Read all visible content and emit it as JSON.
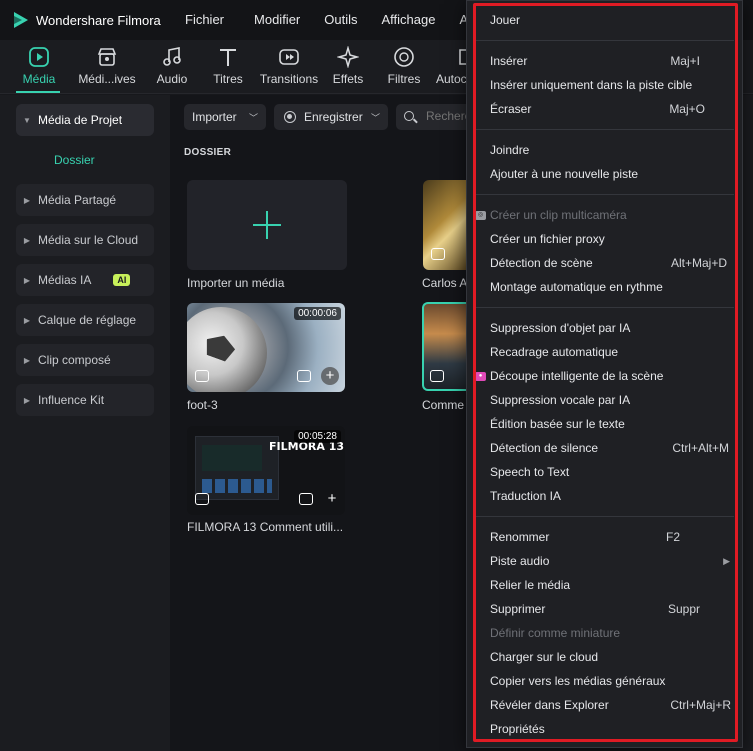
{
  "app": {
    "title": "Wondershare Filmora",
    "menus": [
      "Fichier",
      "Modifier",
      "Outils",
      "Affichage",
      "Aide"
    ]
  },
  "toolbar": {
    "tabs": [
      {
        "label": "Média",
        "icon": "media-icon",
        "active": true
      },
      {
        "label": "Médi...ives",
        "icon": "store-icon",
        "active": false
      },
      {
        "label": "Audio",
        "icon": "music-note-icon",
        "active": false
      },
      {
        "label": "Titres",
        "icon": "text-t-icon",
        "active": false
      },
      {
        "label": "Transitions",
        "icon": "transition-icon",
        "active": false
      },
      {
        "label": "Effets",
        "icon": "effects-sparkle-icon",
        "active": false
      },
      {
        "label": "Filtres",
        "icon": "filter-icon",
        "active": false
      },
      {
        "label": "Autoc",
        "icon": "sticker-icon",
        "active": false
      }
    ],
    "accent": "#38d2b0"
  },
  "sidebar": {
    "items": [
      {
        "label": "Média de Projet",
        "expanded": true
      },
      {
        "label": "Média Partagé"
      },
      {
        "label": "Média sur le Cloud"
      },
      {
        "label": "Médias IA",
        "badge": "AI"
      },
      {
        "label": "Calque de réglage"
      },
      {
        "label": "Clip composé"
      },
      {
        "label": "Influence Kit"
      }
    ],
    "sub_item": "Dossier"
  },
  "content": {
    "import_label": "Importer",
    "record_label": "Enregistrer",
    "search_placeholder": "Recherc",
    "section_label": "DOSSIER",
    "items": [
      {
        "label": "Importer un média"
      },
      {
        "label": "Carlos A"
      },
      {
        "label": "foot-3",
        "duration": "00:00:06"
      },
      {
        "label": "Comme"
      },
      {
        "label": "FILMORA 13  Comment utili...",
        "duration": "00:05:28",
        "overlay_text": "FILMORA 13"
      }
    ]
  },
  "context_menu": {
    "items": [
      {
        "label": "Jouer",
        "shortcut": ""
      },
      {
        "label": "Insérer",
        "shortcut": "Maj+I"
      },
      {
        "label": "Insérer uniquement dans la piste cible",
        "shortcut": ""
      },
      {
        "label": "Écraser",
        "shortcut": "Maj+O"
      },
      {
        "label": "Joindre",
        "shortcut": ""
      },
      {
        "label": "Ajouter à une nouvelle piste",
        "shortcut": ""
      },
      {
        "label": "Créer un clip multicaméra",
        "shortcut": "",
        "disabled": true
      },
      {
        "label": "Créer un fichier proxy",
        "shortcut": ""
      },
      {
        "label": "Détection de scène",
        "shortcut": "Alt+Maj+D"
      },
      {
        "label": "Montage automatique en rythme",
        "shortcut": ""
      },
      {
        "label": "Suppression d'objet par IA",
        "shortcut": ""
      },
      {
        "label": "Recadrage automatique",
        "shortcut": ""
      },
      {
        "label": "Découpe intelligente de la scène",
        "shortcut": ""
      },
      {
        "label": "Suppression vocale par IA",
        "shortcut": ""
      },
      {
        "label": "Édition basée sur le texte",
        "shortcut": ""
      },
      {
        "label": "Détection de silence",
        "shortcut": "Ctrl+Alt+M"
      },
      {
        "label": "Speech to Text",
        "shortcut": ""
      },
      {
        "label": "Traduction IA",
        "shortcut": ""
      },
      {
        "label": "Renommer",
        "shortcut": "F2"
      },
      {
        "label": "Piste audio",
        "shortcut": ""
      },
      {
        "label": "Relier le média",
        "shortcut": ""
      },
      {
        "label": "Supprimer",
        "shortcut": "Suppr"
      },
      {
        "label": "Définir comme miniature",
        "shortcut": "",
        "disabled": true
      },
      {
        "label": "Charger sur le cloud",
        "shortcut": ""
      },
      {
        "label": "Copier vers les médias généraux",
        "shortcut": ""
      },
      {
        "label": "Révéler dans Explorer",
        "shortcut": "Ctrl+Maj+R"
      },
      {
        "label": "Propriétés",
        "shortcut": ""
      }
    ],
    "highlight_color": "#e01b24"
  }
}
